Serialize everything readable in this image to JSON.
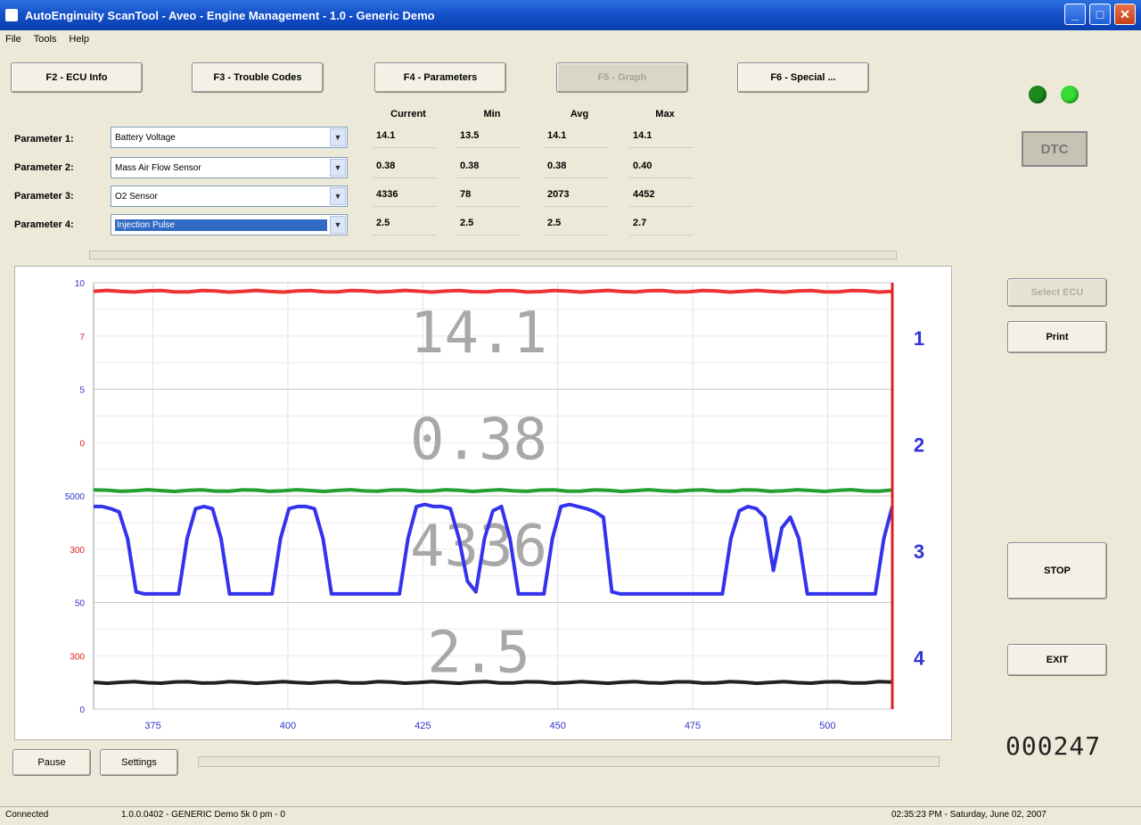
{
  "window": {
    "title": "AutoEnginuity ScanTool - Aveo - Engine Management - 1.0 - Generic Demo",
    "minimize": "_",
    "maximize": "□",
    "close": "✕"
  },
  "menu": [
    "File",
    "Tools",
    "Help"
  ],
  "function_buttons": [
    {
      "label": "F2 - ECU Info",
      "enabled": true
    },
    {
      "label": "F3 - Trouble Codes",
      "enabled": true
    },
    {
      "label": "F4 - Parameters",
      "enabled": true
    },
    {
      "label": "F5 - Graph",
      "enabled": false
    },
    {
      "label": "F6 - Special ...",
      "enabled": true
    }
  ],
  "indicators": {
    "led_colors": [
      "#1a8a1a",
      "#33dd33"
    ],
    "dtc_label": "DTC"
  },
  "columns": [
    "Current",
    "Min",
    "Avg",
    "Max"
  ],
  "parameters": [
    {
      "label": "Parameter 1:",
      "selection": "Battery Voltage",
      "current": "14.1",
      "min": "13.5",
      "avg": "14.1",
      "max": "14.1"
    },
    {
      "label": "Parameter 2:",
      "selection": "Mass Air Flow Sensor",
      "current": "0.38",
      "min": "0.38",
      "avg": "0.38",
      "max": "0.40"
    },
    {
      "label": "Parameter 3:",
      "selection": "O2 Sensor",
      "current": "4336",
      "min": "78",
      "avg": "2073",
      "max": "4452"
    },
    {
      "label": "Parameter 4:",
      "selection": "Injection Pulse",
      "current": "2.5",
      "min": "2.5",
      "avg": "2.5",
      "max": "2.7"
    }
  ],
  "side_buttons": {
    "select_ecu": "Select ECU",
    "print": "Print",
    "stop": "STOP",
    "exit": "EXIT"
  },
  "counter": "000247",
  "bottom_buttons": {
    "pause": "Pause",
    "settings": "Settings"
  },
  "status": {
    "left": "Connected",
    "middle": "1.0.0.0402 - GENERIC Demo 5k 0 pm - 0",
    "right": "02:35:23 PM - Saturday, June 02, 2007"
  },
  "chart_data": {
    "type": "line",
    "x_ticks": [
      375,
      400,
      425,
      450,
      475,
      500
    ],
    "xlim": [
      364,
      512
    ],
    "left_ticks": [
      "10",
      "7",
      "5",
      "0",
      "5000",
      "300",
      "50",
      "300",
      "0"
    ],
    "left_tick_colors": [
      "#3333cc",
      "#dd2222",
      "#3333cc",
      "#dd2222",
      "#3333cc",
      "#dd2222",
      "#3333cc",
      "#dd2222",
      "#3333cc"
    ],
    "lane_labels": [
      "1",
      "2",
      "3",
      "4"
    ],
    "overlays": [
      "14.1",
      "0.38",
      "4336",
      "2.5"
    ],
    "series": [
      {
        "color": "#ee3333",
        "lane": 1,
        "level": 0.92
      },
      {
        "color": "#22a033",
        "lane": 2,
        "level": 0.05
      },
      {
        "color": "#3333ee",
        "lane": 3,
        "values": [
          0.9,
          0.9,
          0.88,
          0.85,
          0.6,
          0.1,
          0.08,
          0.08,
          0.08,
          0.08,
          0.08,
          0.6,
          0.88,
          0.9,
          0.88,
          0.6,
          0.08,
          0.08,
          0.08,
          0.08,
          0.08,
          0.08,
          0.6,
          0.88,
          0.9,
          0.9,
          0.88,
          0.6,
          0.08,
          0.08,
          0.08,
          0.08,
          0.08,
          0.08,
          0.08,
          0.08,
          0.08,
          0.6,
          0.9,
          0.92,
          0.9,
          0.9,
          0.88,
          0.6,
          0.2,
          0.1,
          0.6,
          0.86,
          0.9,
          0.6,
          0.08,
          0.08,
          0.08,
          0.08,
          0.6,
          0.9,
          0.92,
          0.9,
          0.88,
          0.85,
          0.8,
          0.1,
          0.08,
          0.08,
          0.08,
          0.08,
          0.08,
          0.08,
          0.08,
          0.08,
          0.08,
          0.08,
          0.08,
          0.08,
          0.08,
          0.6,
          0.86,
          0.9,
          0.88,
          0.8,
          0.3,
          0.7,
          0.8,
          0.6,
          0.08,
          0.08,
          0.08,
          0.08,
          0.08,
          0.08,
          0.08,
          0.08,
          0.08,
          0.6,
          0.9
        ]
      },
      {
        "color": "#222222",
        "lane": 4,
        "level": 0.25
      }
    ]
  }
}
